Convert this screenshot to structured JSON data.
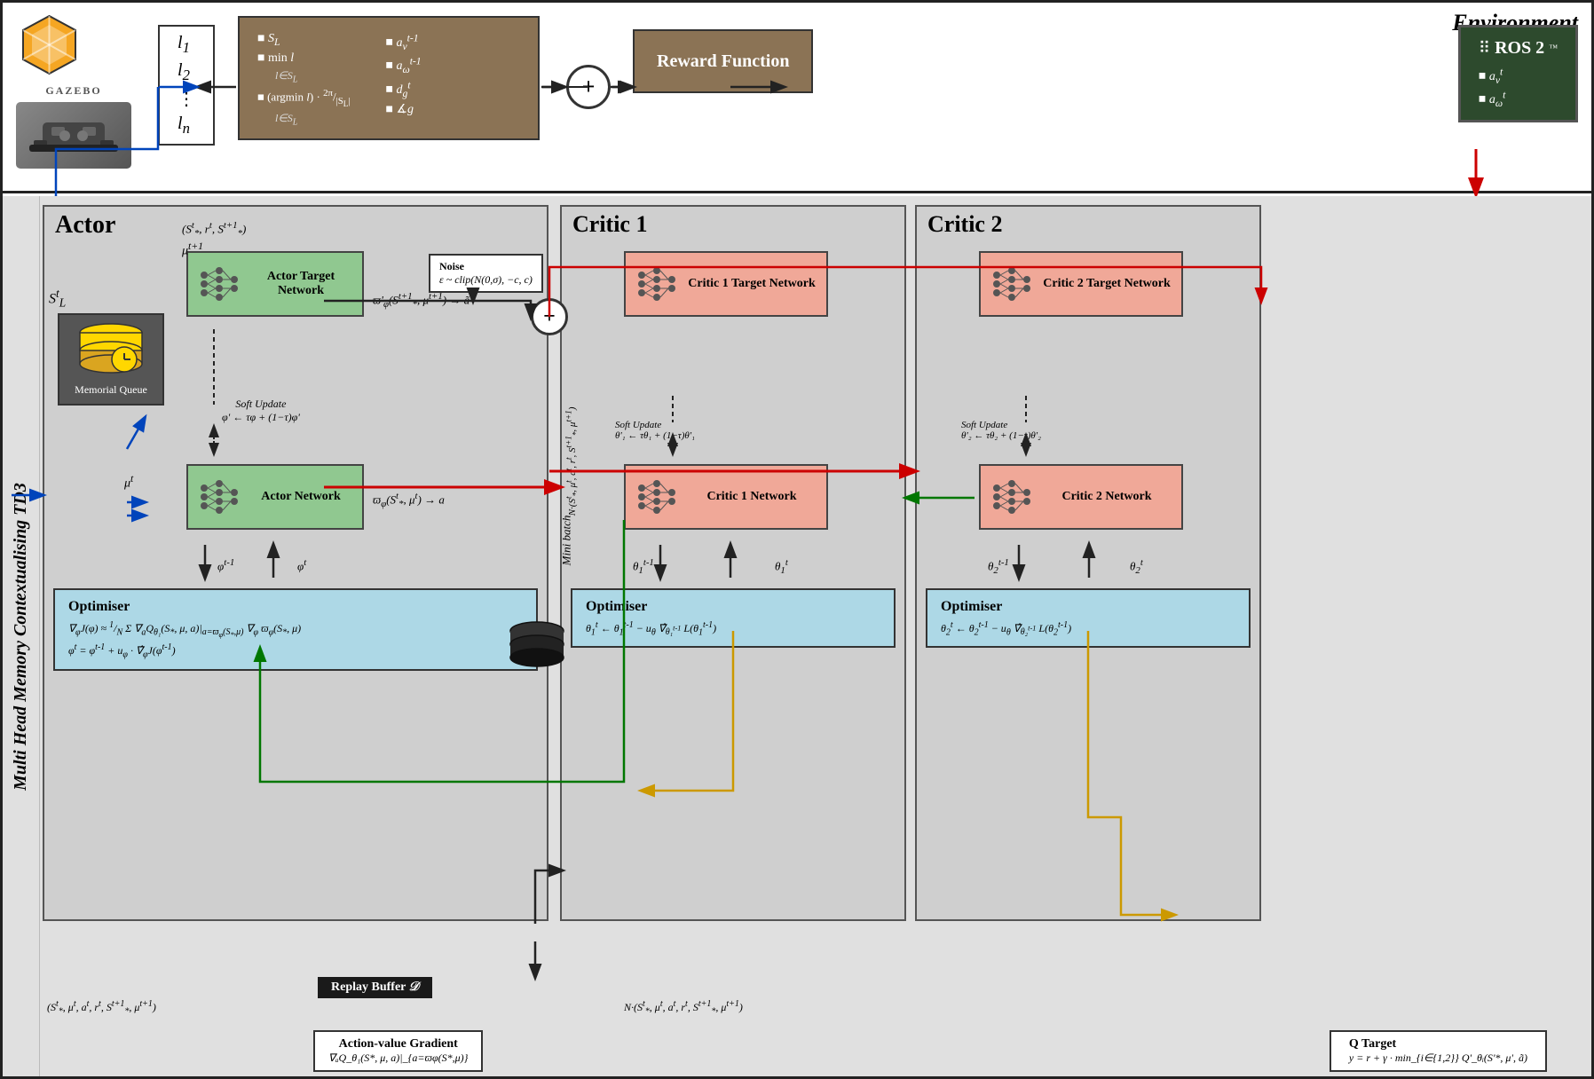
{
  "environment": {
    "label": "Environment",
    "gazebo_label": "GAZEBO",
    "lidar_items": [
      "l₁",
      "l₂",
      "⋮",
      "lₙ"
    ],
    "brown_box": {
      "line1": "S_L",
      "line2": "min l",
      "line2_sub": "l∈S_L",
      "line3": "(argmin l) · 2π/|S_L|",
      "line3_sub": "l∈S_L",
      "line4": "a_v^{t-1}",
      "line5": "a_ω^{t-1}",
      "line6": "d_g^t",
      "line7": "∡g"
    },
    "reward_function": "Reward\nFunction",
    "ros2_label": "ROS 2",
    "ros2_items": [
      "a_v^t",
      "a_ω^t"
    ]
  },
  "algorithm": {
    "label": "Multi Head Memory Contextualising TD3",
    "actor_label": "Actor",
    "critic1_label": "Critic 1",
    "critic2_label": "Critic 2",
    "memorial_queue_label": "Memorial Queue",
    "actor_target_network": "Actor\nTarget\nNetwork",
    "actor_network": "Actor\nNetwork",
    "actor_target_formula": "ϖ'φ(S*^{t+1}, μ^{t+1}) → ã'",
    "actor_formula": "ϖφ(S*^t, μ^t) → a",
    "soft_update_actor": "Soft Update\nφ' ← τφ + (1−τ)φ'",
    "phi_labels": [
      "φ^{t-1}",
      "φ^t"
    ],
    "noise_label": "Noise",
    "noise_formula": "ε ~ clip(N(0,σ), −c, c)",
    "critic1_target": "Critic 1\nTarget\nNetwork",
    "critic1_network": "Critic 1\nNetwork",
    "soft_update_critic1": "Soft Update\nθ'₁ ← τθ₁ + (1−τ)θ'₁",
    "theta1_labels": [
      "θ₁^{t-1}",
      "θ₁^t"
    ],
    "critic2_target": "Critic 2\nTarget\nNetwork",
    "critic2_network": "Critic 2\nNetwork",
    "soft_update_critic2": "Soft Update\nθ'₂ ← τθ₂ + (1−τ)θ'₂",
    "theta2_labels": [
      "θ₂^{t-1}",
      "θ₂^t"
    ],
    "optimiser_actor": {
      "title": "Optimiser",
      "line1": "∇φJ(φ) ≈ 1/N Σ ∇ₐQ_θ₁(S*, μ, a)|_{a=ϖφ(S*,μ)} ∇φ ϖφ(S*, μ)",
      "line2": "φ^t = φ^{t-1} + uφ · ∇̂φJ(φ^{t-1})"
    },
    "optimiser_critic1": {
      "title": "Optimiser",
      "formula": "θ₁^t ← θ₁^{t-1} − uθ ∇̂_{θ₁^{t-1}} L(θ₁^{t-1})"
    },
    "optimiser_critic2": {
      "title": "Optimiser",
      "formula": "θ₂^t ← θ₂^{t-1} − uθ ∇̂_{θ₂^{t-1}} L(θ₂^{t-1})"
    },
    "minibatch_label": "Mini batch",
    "minibatch_formula": "N·(S*^t, μ^t, a^t, r^t, S*^{t+1}, μ^{t+1})",
    "replay_buffer": "Replay Buffer 𝒟",
    "bottom_tuple": "(S*^t, μ^t, a^t, r^t, S*^{t+1}, μ^{t+1})",
    "top_tuple": "N·(S*^t, μ^t, a^t, r^t, S*^{t+1}, μ^{t+1})",
    "action_gradient": {
      "title": "Action-value Gradient",
      "formula": "∇ₐQ_θ₁(S*, μ, a)|_{a=ϖφ(S*,μ)}"
    },
    "q_target": {
      "title": "Q Target",
      "formula": "y = r + γ · min_{i∈{1,2}} Q'_θᵢ(S'*, μ', ã)"
    },
    "state_label": "S_L^t",
    "mu_t": "μ^t",
    "mu_t1": "μ^{t+1}",
    "state_tuple_above": "(S*ₜ, r^t, S*^{t+1})"
  },
  "colors": {
    "brown": "#8B7355",
    "green_network": "#90c890",
    "pink_network": "#f0a898",
    "blue_opt": "#add8e6",
    "dark_green_ros": "#2d4a2d",
    "red_arrow": "#cc0000",
    "blue_arrow": "#0000cc",
    "green_arrow": "#007700",
    "yellow_arrow": "#ccaa00",
    "black_arrow": "#111111"
  }
}
